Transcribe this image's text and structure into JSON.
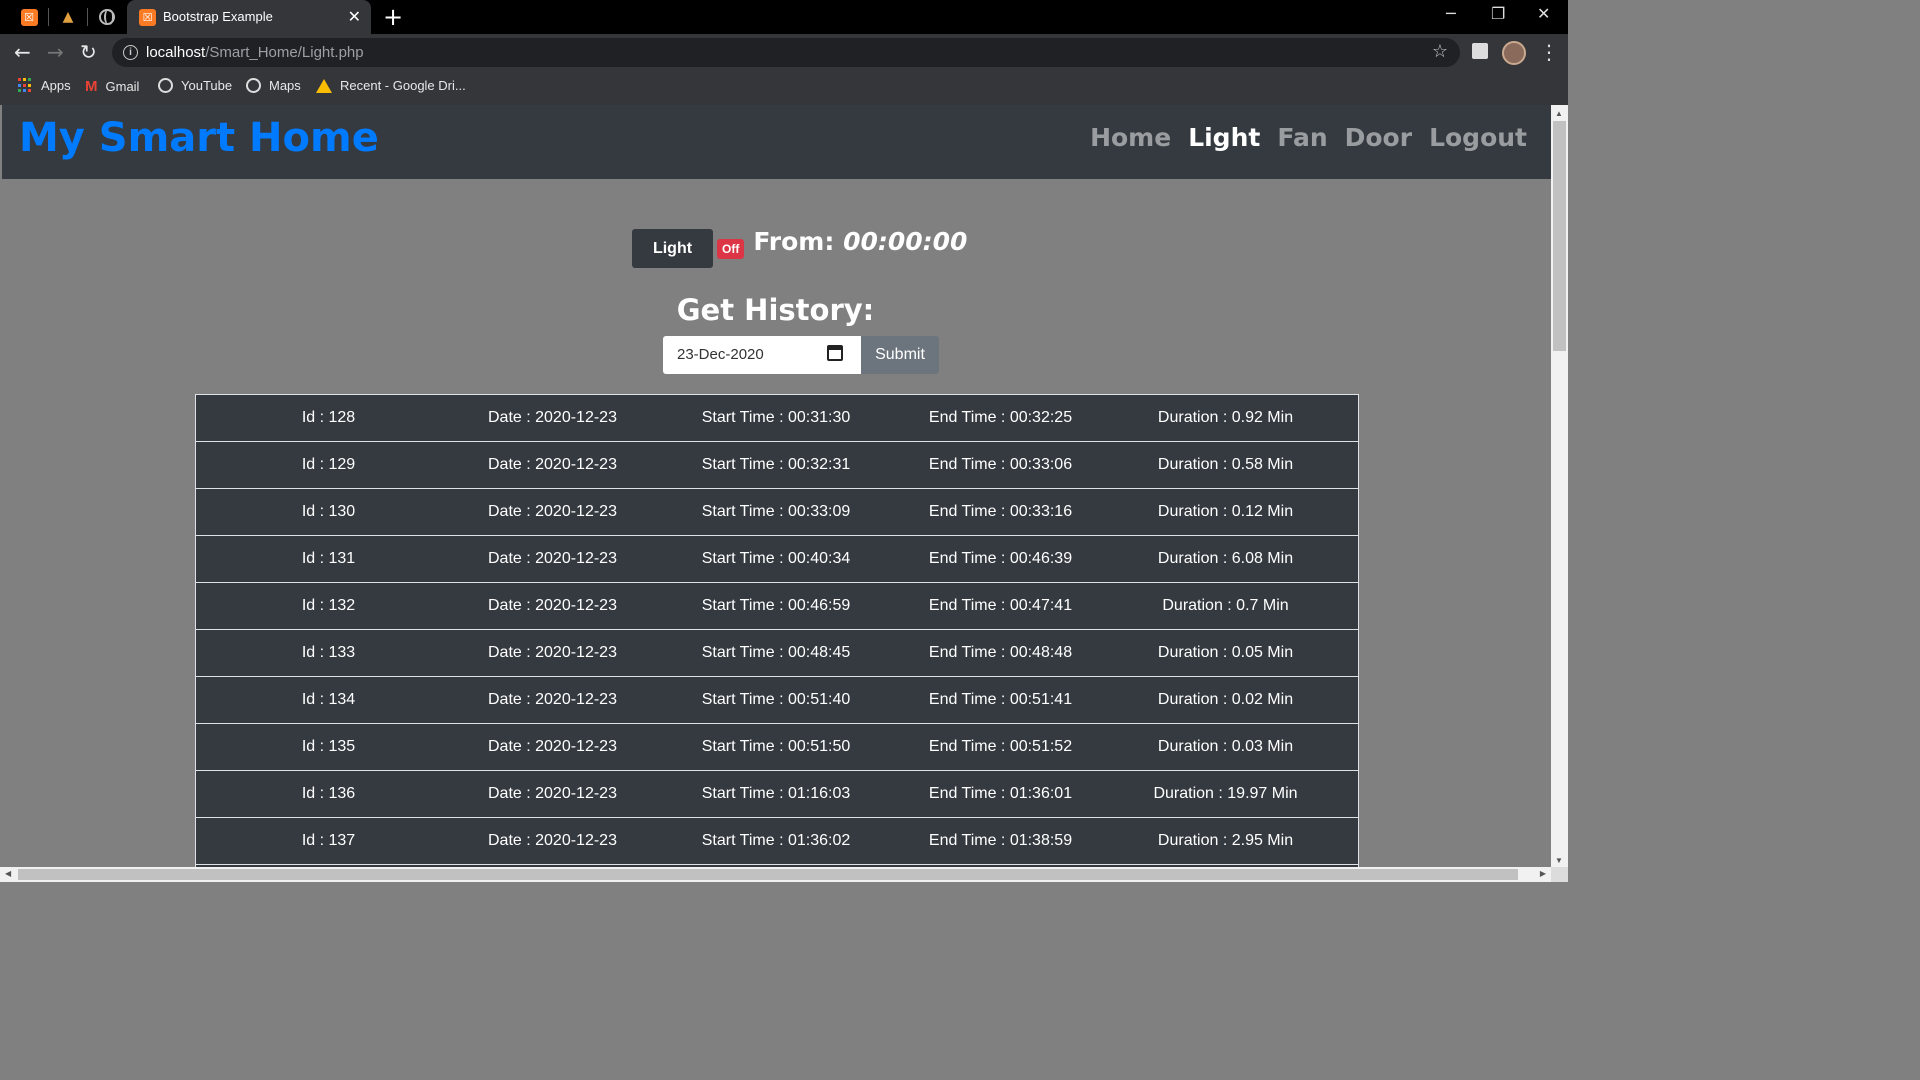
{
  "browser": {
    "active_tab_title": "Bootstrap Example",
    "url_host": "localhost",
    "url_path": "/Smart_Home/Light.php",
    "bookmarks": [
      {
        "label": "Apps",
        "icon": "apps-grid-icon"
      },
      {
        "label": "Gmail",
        "icon": "gmail-icon"
      },
      {
        "label": "YouTube",
        "icon": "globe-icon"
      },
      {
        "label": "Maps",
        "icon": "globe-icon"
      },
      {
        "label": "Recent - Google Dri...",
        "icon": "google-drive-icon"
      }
    ]
  },
  "navbar": {
    "brand": "My Smart Home",
    "links": [
      {
        "label": "Home",
        "active": false
      },
      {
        "label": "Light",
        "active": true
      },
      {
        "label": "Fan",
        "active": false
      },
      {
        "label": "Door",
        "active": false
      },
      {
        "label": "Logout",
        "active": false
      }
    ]
  },
  "status": {
    "device_button": "Light",
    "state_badge": "Off",
    "from_label": "From:",
    "from_time": "00:00:00"
  },
  "history": {
    "title": "Get History:",
    "date_value": "23-Dec-2020",
    "submit_label": "Submit",
    "rows": [
      {
        "id": "Id : 128",
        "date": "Date : 2020-12-23",
        "start": "Start Time : 00:31:30",
        "end": "End Time : 00:32:25",
        "duration": "Duration : 0.92 Min"
      },
      {
        "id": "Id : 129",
        "date": "Date : 2020-12-23",
        "start": "Start Time : 00:32:31",
        "end": "End Time : 00:33:06",
        "duration": "Duration : 0.58 Min"
      },
      {
        "id": "Id : 130",
        "date": "Date : 2020-12-23",
        "start": "Start Time : 00:33:09",
        "end": "End Time : 00:33:16",
        "duration": "Duration : 0.12 Min"
      },
      {
        "id": "Id : 131",
        "date": "Date : 2020-12-23",
        "start": "Start Time : 00:40:34",
        "end": "End Time : 00:46:39",
        "duration": "Duration : 6.08 Min"
      },
      {
        "id": "Id : 132",
        "date": "Date : 2020-12-23",
        "start": "Start Time : 00:46:59",
        "end": "End Time : 00:47:41",
        "duration": "Duration : 0.7 Min"
      },
      {
        "id": "Id : 133",
        "date": "Date : 2020-12-23",
        "start": "Start Time : 00:48:45",
        "end": "End Time : 00:48:48",
        "duration": "Duration : 0.05 Min"
      },
      {
        "id": "Id : 134",
        "date": "Date : 2020-12-23",
        "start": "Start Time : 00:51:40",
        "end": "End Time : 00:51:41",
        "duration": "Duration : 0.02 Min"
      },
      {
        "id": "Id : 135",
        "date": "Date : 2020-12-23",
        "start": "Start Time : 00:51:50",
        "end": "End Time : 00:51:52",
        "duration": "Duration : 0.03 Min"
      },
      {
        "id": "Id : 136",
        "date": "Date : 2020-12-23",
        "start": "Start Time : 01:16:03",
        "end": "End Time : 01:36:01",
        "duration": "Duration : 19.97 Min"
      },
      {
        "id": "Id : 137",
        "date": "Date : 2020-12-23",
        "start": "Start Time : 01:36:02",
        "end": "End Time : 01:38:59",
        "duration": "Duration : 2.95 Min"
      }
    ]
  },
  "colors": {
    "brand": "#007bff",
    "navbar_bg": "#343a40",
    "page_bg": "#808080",
    "badge_off": "#dc3545",
    "submit_bg": "#6c757d"
  }
}
